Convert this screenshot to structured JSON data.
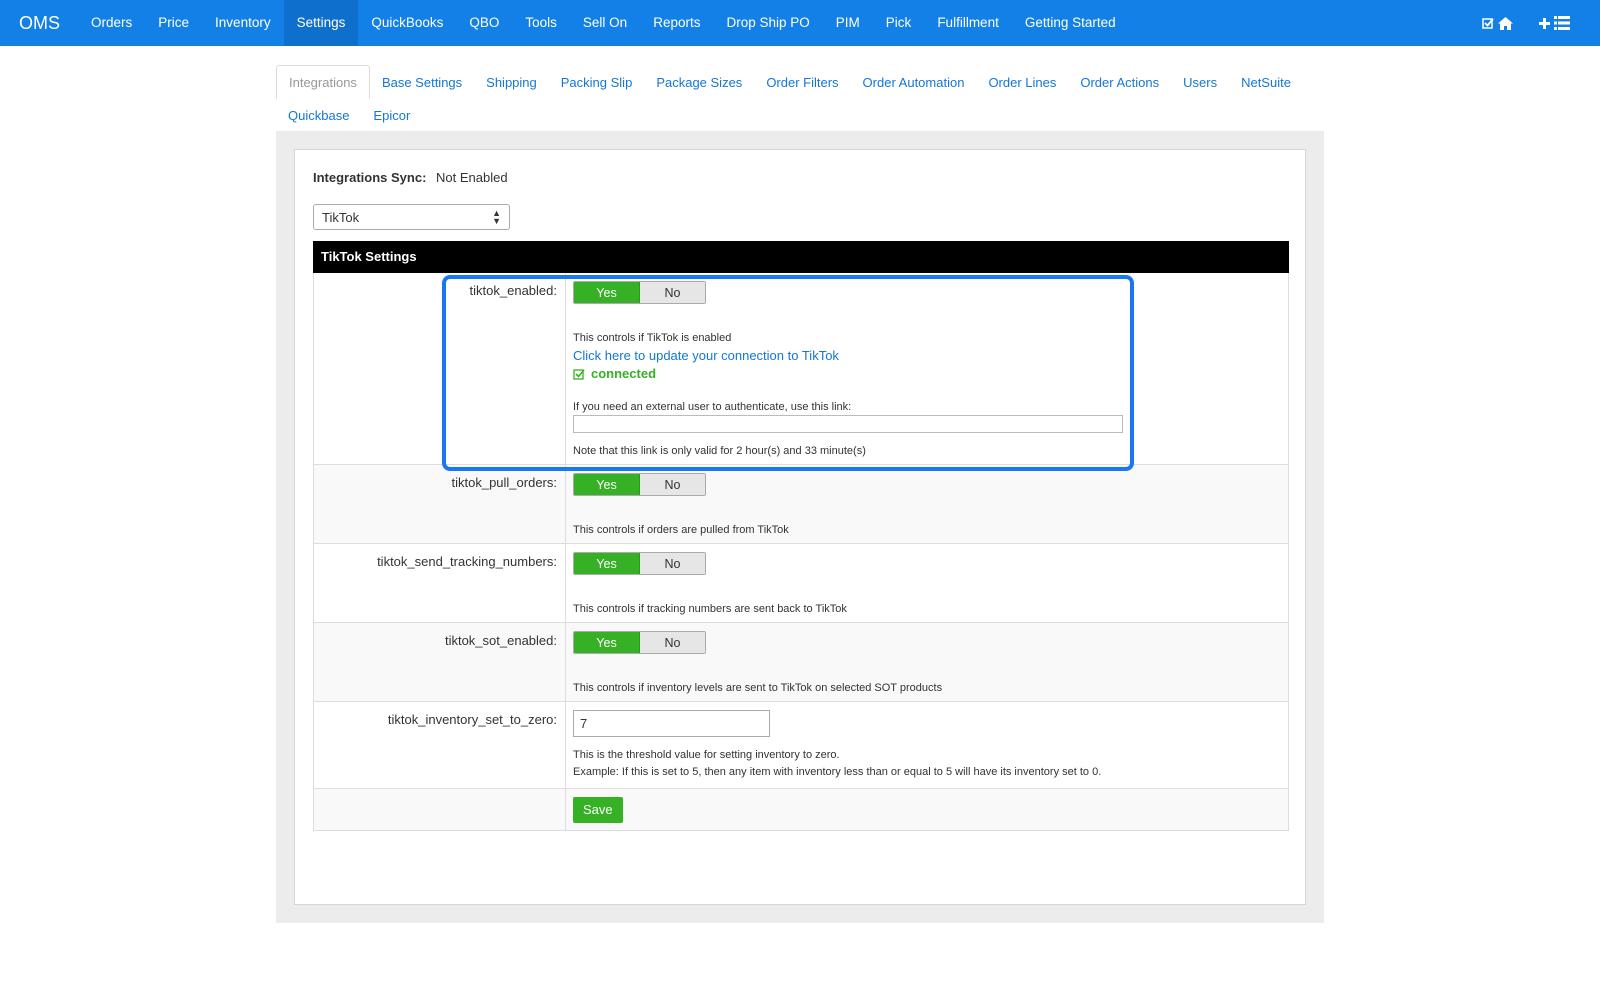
{
  "navbar": {
    "brand": "OMS",
    "items": [
      "Orders",
      "Price",
      "Inventory",
      "Settings",
      "QuickBooks",
      "QBO",
      "Tools",
      "Sell On",
      "Reports",
      "Drop Ship PO",
      "PIM",
      "Pick",
      "Fulfillment",
      "Getting Started"
    ],
    "active": "Settings",
    "right_icons": [
      "check-square-icon",
      "home-icon",
      "plus-icon",
      "list-icon"
    ]
  },
  "tabs": {
    "row1": [
      "Integrations",
      "Base Settings",
      "Shipping",
      "Packing Slip",
      "Package Sizes",
      "Order Filters",
      "Order Automation",
      "Order Lines",
      "Order Actions",
      "Users",
      "NetSuite"
    ],
    "row2": [
      "Quickbase",
      "Epicor"
    ],
    "active": "Integrations"
  },
  "sync": {
    "label": "Integrations Sync:",
    "value": "Not Enabled"
  },
  "integration_select": {
    "value": "TikTok"
  },
  "settings": {
    "header": "TikTok Settings",
    "enabled": {
      "label": "tiktok_enabled:",
      "yes": "Yes",
      "no": "No",
      "desc": "This controls if TikTok is enabled",
      "link": "Click here to update your connection to TikTok",
      "status": "connected",
      "external_label": "If you need an external user to authenticate, use this link:",
      "external_value": "",
      "note": "Note that this link is only valid for 2 hour(s) and 33 minute(s)"
    },
    "pull_orders": {
      "label": "tiktok_pull_orders:",
      "yes": "Yes",
      "no": "No",
      "desc": "This controls if orders are pulled from TikTok"
    },
    "send_tracking": {
      "label": "tiktok_send_tracking_numbers:",
      "yes": "Yes",
      "no": "No",
      "desc": "This controls if tracking numbers are sent back to TikTok"
    },
    "sot_enabled": {
      "label": "tiktok_sot_enabled:",
      "yes": "Yes",
      "no": "No",
      "desc": "This controls if inventory levels are sent to TikTok on selected SOT products"
    },
    "inventory_zero": {
      "label": "tiktok_inventory_set_to_zero:",
      "value": "7",
      "desc1": "This is the threshold value for setting inventory to zero.",
      "desc2": "Example: If this is set to 5, then any item with inventory less than or equal to 5 will have its inventory set to 0."
    },
    "save_label": "Save"
  },
  "colors": {
    "nav": "#1380e8",
    "accent_green": "#36b024",
    "link": "#1377d6",
    "highlight": "#1877f2"
  }
}
